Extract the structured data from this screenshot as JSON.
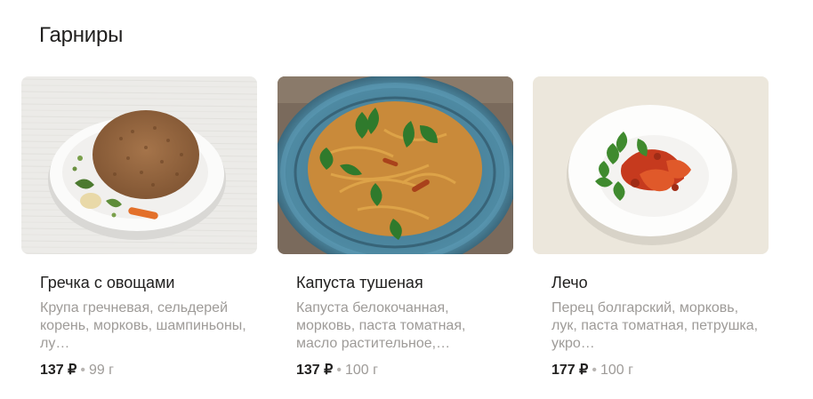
{
  "section": {
    "title": "Гарниры"
  },
  "items": [
    {
      "name": "Гречка с овощами",
      "description": "Крупа гречневая, сельдерей корень, морковь, шампиньоны, лу…",
      "price": "137 ₽",
      "weight": "99 г"
    },
    {
      "name": "Капуста тушеная",
      "description": "Капуста белокочанная, морковь, паста томатная, масло растительное,…",
      "price": "137 ₽",
      "weight": "100 г"
    },
    {
      "name": "Лечо",
      "description": "Перец болгарский, морковь, лук, паста томатная, петрушка, укро…",
      "price": "177 ₽",
      "weight": "100 г"
    }
  ],
  "separator": "•"
}
